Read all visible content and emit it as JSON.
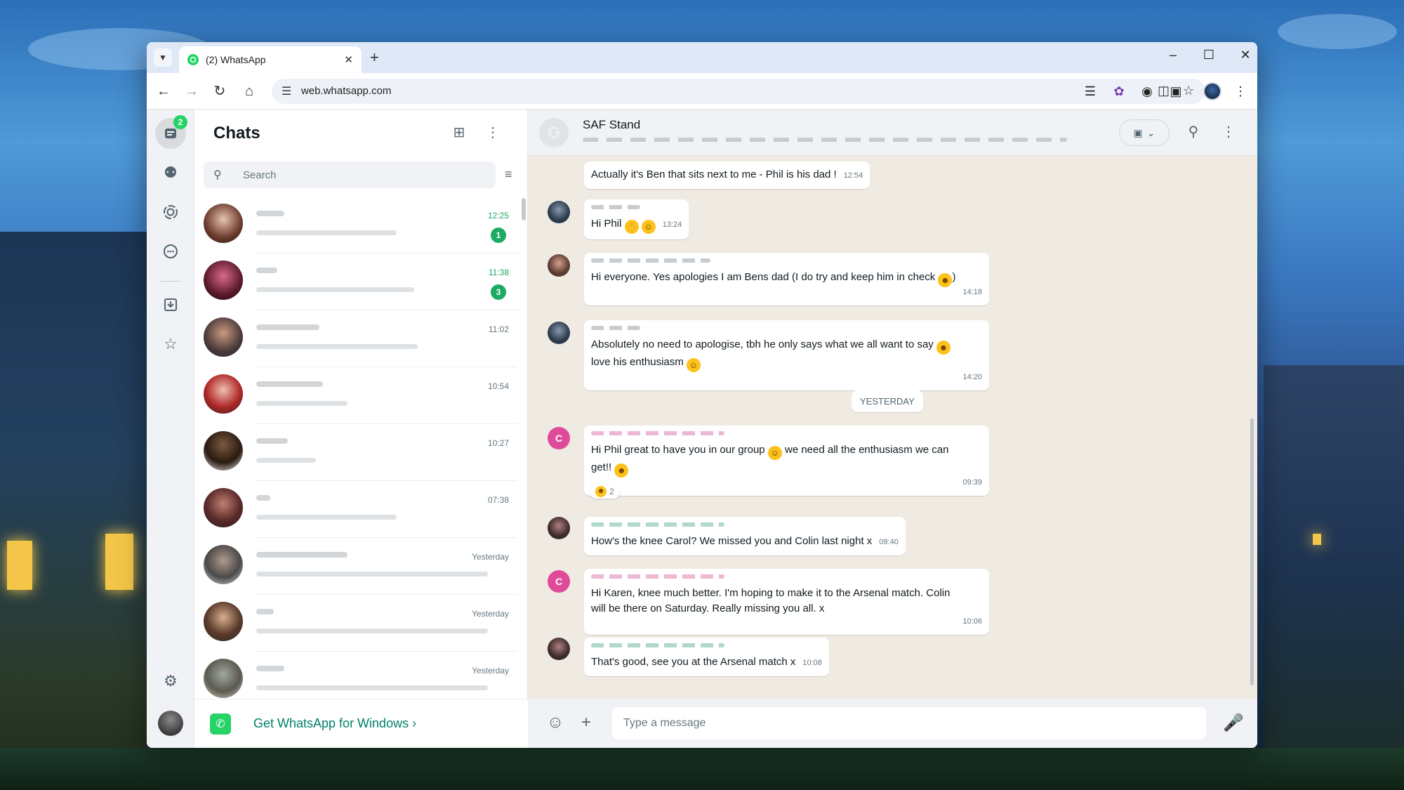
{
  "browser": {
    "tab_title": "(2) WhatsApp",
    "url": "web.whatsapp.com"
  },
  "rail": {
    "chats_badge": "2"
  },
  "chat_list": {
    "title": "Chats",
    "search_placeholder": "Search",
    "rows": [
      {
        "time": "12:25",
        "unread": "1"
      },
      {
        "time": "11:38",
        "unread": "3"
      },
      {
        "time": "11:02"
      },
      {
        "time": "10:54"
      },
      {
        "time": "10:27"
      },
      {
        "time": "07:38"
      },
      {
        "time": "Yesterday"
      },
      {
        "time": "Yesterday"
      },
      {
        "time": "Yesterday"
      }
    ],
    "get_windows_label": "Get WhatsApp for Windows"
  },
  "conversation": {
    "group_name": "SAF Stand",
    "date_divider": "YESTERDAY",
    "messages": [
      {
        "text": "Actually it's Ben that sits next to me - Phil is his dad !",
        "time": "12:54"
      },
      {
        "text": "Hi Phil",
        "time": "13:24"
      },
      {
        "text": "Hi everyone. Yes apologies I am Bens dad (I do try and keep him in check",
        "text_end": ")",
        "time": "14:18"
      },
      {
        "text": "Absolutely no need to apologise, tbh he only says what we all want to say",
        "text2": "love his enthusiasm",
        "time": "14:20"
      },
      {
        "text": "Hi Phil great to have you in our group",
        "text_mid": "we need all the enthusiasm we can",
        "text2": "get!!",
        "time": "09:39",
        "reaction_count": "2"
      },
      {
        "text": "How's the knee Carol? We missed you and Colin last night x",
        "time": "09:40"
      },
      {
        "text": "Hi Karen, knee much better. I'm hoping to make it to the Arsenal  match. Colin",
        "text2": "will be there on Saturday. Really missing you all. x",
        "time": "10:06"
      },
      {
        "text": "That's good, see you at the Arsenal match x",
        "time": "10:08"
      }
    ],
    "avatar_letter": "C",
    "composer_placeholder": "Type a message"
  },
  "colors": {
    "whatsapp_green": "#25d366",
    "unread_green": "#1daa61",
    "chat_bg": "#efeae2",
    "accent_pink": "#e04a9a"
  }
}
